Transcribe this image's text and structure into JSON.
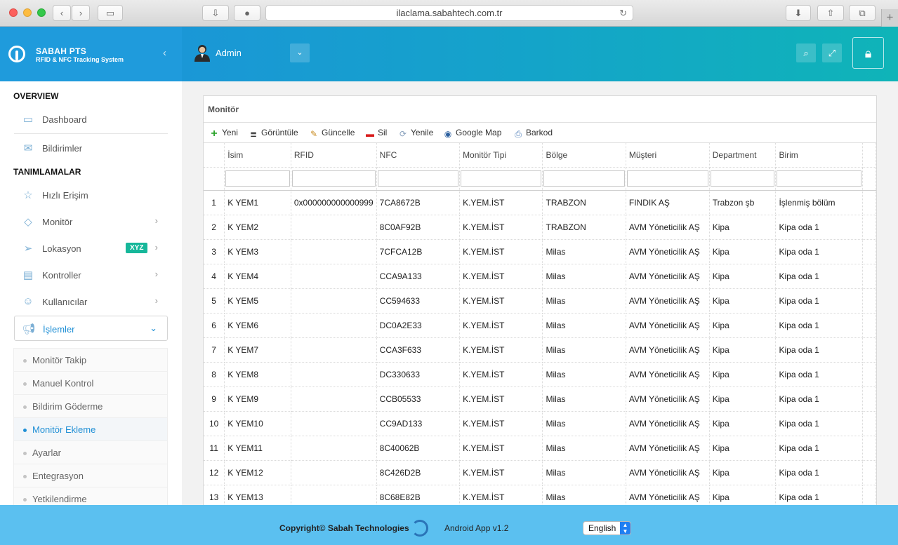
{
  "browser": {
    "url": "ilaclama.sabahtech.com.tr"
  },
  "brand": {
    "title": "SABAH PTS",
    "subtitle": "RFID & NFC Tracking System"
  },
  "header": {
    "user": "Admin"
  },
  "sidebar": {
    "section1": "OVERVIEW",
    "dashboard": "Dashboard",
    "bildirimler": "Bildirimler",
    "section2": "TANIMLAMALAR",
    "hizli": "Hızlı Erişim",
    "monitor": "Monitör",
    "lokasyon": "Lokasyon",
    "lokasyon_badge": "XYZ",
    "kontroller": "Kontroller",
    "kullanicilar": "Kullanıcılar",
    "islemler": "İşlemler",
    "sub": [
      "Monitör Takip",
      "Manuel Kontrol",
      "Bildirim Göderme",
      "Monitör Ekleme",
      "Ayarlar",
      "Entegrasyon",
      "Yetkilendirme"
    ]
  },
  "panel": {
    "title": "Monitör",
    "toolbar": {
      "yeni": "Yeni",
      "goruntule": "Görüntüle",
      "guncelle": "Güncelle",
      "sil": "Sil",
      "yenile": "Yenile",
      "map": "Google Map",
      "barkod": "Barkod"
    },
    "columns": [
      "İsim",
      "RFID",
      "NFC",
      "Monitör Tipi",
      "Bölge",
      "Müşteri",
      "Department",
      "Birim"
    ],
    "rows": [
      [
        "1",
        "K YEM1",
        "0x000000000000999",
        "7CA8672B",
        "K.YEM.İST",
        "TRABZON",
        "FINDIK AŞ",
        "Trabzon şb",
        "İşlenmiş bölüm"
      ],
      [
        "2",
        "K YEM2",
        "",
        "8C0AF92B",
        "K.YEM.İST",
        "TRABZON",
        "AVM Yöneticilik AŞ",
        "Kipa",
        "Kipa oda 1"
      ],
      [
        "3",
        "K YEM3",
        "",
        "7CFCA12B",
        "K.YEM.İST",
        "Milas",
        "AVM Yöneticilik AŞ",
        "Kipa",
        "Kipa oda 1"
      ],
      [
        "4",
        "K YEM4",
        "",
        "CCA9A133",
        "K.YEM.İST",
        "Milas",
        "AVM Yöneticilik AŞ",
        "Kipa",
        "Kipa oda 1"
      ],
      [
        "5",
        "K YEM5",
        "",
        "CC594633",
        "K.YEM.İST",
        "Milas",
        "AVM Yöneticilik AŞ",
        "Kipa",
        "Kipa oda 1"
      ],
      [
        "6",
        "K YEM6",
        "",
        "DC0A2E33",
        "K.YEM.İST",
        "Milas",
        "AVM Yöneticilik AŞ",
        "Kipa",
        "Kipa oda 1"
      ],
      [
        "7",
        "K YEM7",
        "",
        "CCA3F633",
        "K.YEM.İST",
        "Milas",
        "AVM Yöneticilik AŞ",
        "Kipa",
        "Kipa oda 1"
      ],
      [
        "8",
        "K YEM8",
        "",
        "DC330633",
        "K.YEM.İST",
        "Milas",
        "AVM Yöneticilik AŞ",
        "Kipa",
        "Kipa oda 1"
      ],
      [
        "9",
        "K YEM9",
        "",
        "CCB05533",
        "K.YEM.İST",
        "Milas",
        "AVM Yöneticilik AŞ",
        "Kipa",
        "Kipa oda 1"
      ],
      [
        "10",
        "K YEM10",
        "",
        "CC9AD133",
        "K.YEM.İST",
        "Milas",
        "AVM Yöneticilik AŞ",
        "Kipa",
        "Kipa oda 1"
      ],
      [
        "11",
        "K YEM11",
        "",
        "8C40062B",
        "K.YEM.İST",
        "Milas",
        "AVM Yöneticilik AŞ",
        "Kipa",
        "Kipa oda 1"
      ],
      [
        "12",
        "K YEM12",
        "",
        "8C426D2B",
        "K.YEM.İST",
        "Milas",
        "AVM Yöneticilik AŞ",
        "Kipa",
        "Kipa oda 1"
      ],
      [
        "13",
        "K YEM13",
        "",
        "8C68E82B",
        "K.YEM.İST",
        "Milas",
        "AVM Yöneticilik AŞ",
        "Kipa",
        "Kipa oda 1"
      ]
    ]
  },
  "footer": {
    "copyright": "Copyright© Sabah Technologies",
    "app": "Android App v1.2",
    "language": "English"
  }
}
